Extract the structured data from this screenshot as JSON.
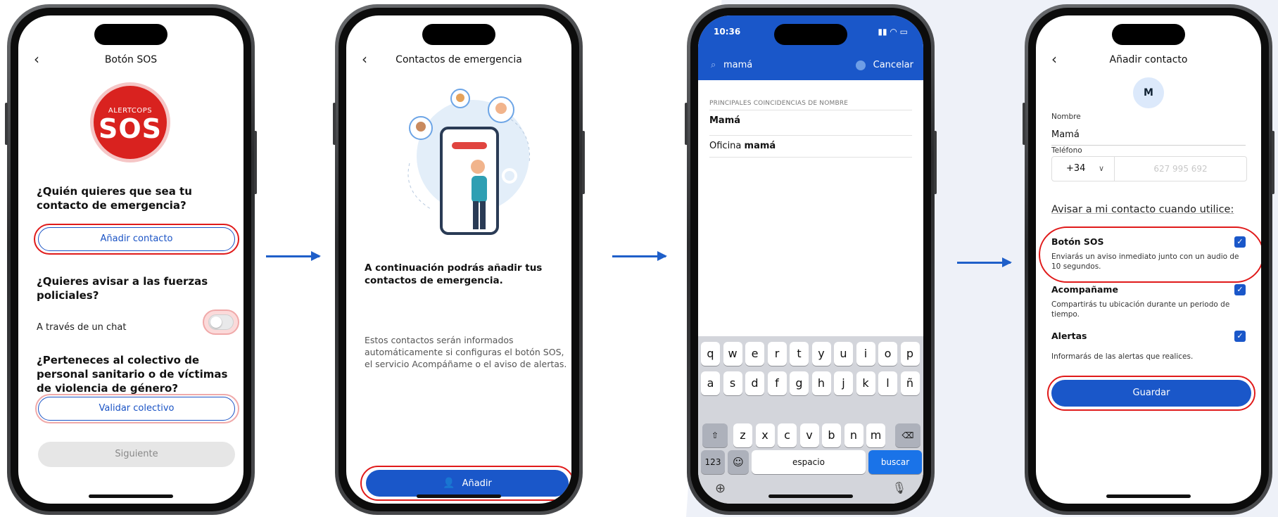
{
  "screen1": {
    "title": "Botón SOS",
    "back": "‹",
    "logo_brand": "ALERTCOPS",
    "logo_text": "SOS",
    "q_contact": "¿Quién quieres que sea tu contacto de emergencia?",
    "add_contact": "Añadir contacto",
    "q_police": "¿Quieres avisar a las fuerzas policiales?",
    "chat_label": "A través de un chat",
    "chat_toggle_on": false,
    "q_collective": "¿Perteneces al colectivo de personal sanitario o de víctimas de violencia de género?",
    "validate": "Validar colectivo",
    "next": "Siguiente"
  },
  "screen2": {
    "title": "Contactos de emergencia",
    "back": "‹",
    "lead": "A continuación podrás añadir tus contactos de emergencia.",
    "desc": "Estos contactos serán informados automáticamente si configuras el botón SOS, el servicio Acompáñame o el aviso de alertas.",
    "add": "Añadir"
  },
  "screen3": {
    "time": "10:36",
    "query": "mamá",
    "cancel": "Cancelar",
    "section": "PRINCIPALES COINCIDENCIAS DE NOMBRE",
    "results": [
      {
        "prefix": "",
        "bold": "Mamá"
      },
      {
        "prefix": "Oficina ",
        "bold": "mamá"
      }
    ],
    "keys_row1": [
      "q",
      "w",
      "e",
      "r",
      "t",
      "y",
      "u",
      "i",
      "o",
      "p"
    ],
    "keys_row2": [
      "a",
      "s",
      "d",
      "f",
      "g",
      "h",
      "j",
      "k",
      "l",
      "ñ"
    ],
    "keys_row3": [
      "z",
      "x",
      "c",
      "v",
      "b",
      "n",
      "m"
    ],
    "key_123": "123",
    "key_space": "espacio",
    "key_search": "buscar"
  },
  "screen4": {
    "title": "Añadir contacto",
    "back": "‹",
    "avatar": "M",
    "name_label": "Nombre",
    "name_value": "Mamá",
    "phone_label": "Teléfono",
    "country_code": "+34",
    "phone_placeholder": "627 995 692",
    "notify_heading": "Avisar a mi contacto cuando utilice:",
    "options": [
      {
        "title": "Botón SOS",
        "desc": "Enviarás un aviso inmediato junto con un audio de 10 segundos.",
        "checked": true
      },
      {
        "title": "Acompañame",
        "desc": "Compartirás tu ubicación durante un periodo de tiempo.",
        "checked": true
      },
      {
        "title": "Alertas",
        "desc": "Informarás de las alertas que realices.",
        "checked": true
      }
    ],
    "save": "Guardar"
  },
  "colors": {
    "primary_blue": "#1a57c9",
    "highlight_red": "#e01a1a",
    "sos_red": "#d9221f",
    "arrow_blue": "#1f5fc9"
  }
}
